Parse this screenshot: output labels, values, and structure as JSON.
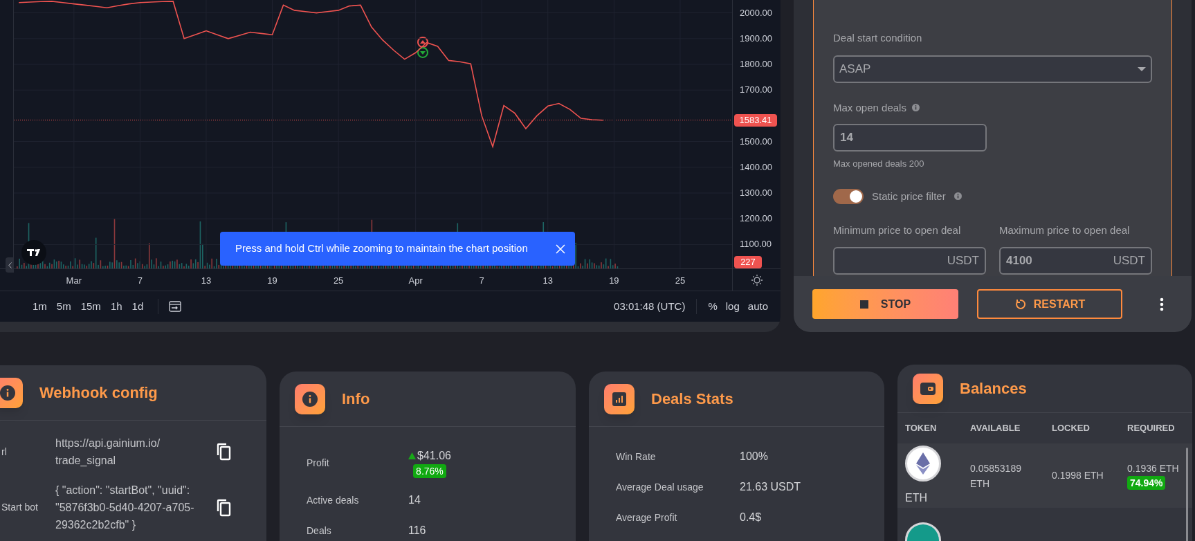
{
  "chart": {
    "volume_label": "227",
    "last_price": "1583.41",
    "chart_data": {
      "type": "line",
      "grid": true,
      "categories": [
        null,
        null,
        null,
        null,
        null,
        "Mar",
        null,
        null,
        null,
        null,
        null,
        "7",
        null,
        null,
        null,
        null,
        null,
        "13",
        null,
        null,
        null,
        null,
        null,
        "19",
        null,
        null,
        null,
        null,
        null,
        "25",
        null,
        null,
        null,
        null,
        null,
        null,
        "Apr",
        null,
        null,
        null,
        null,
        null,
        "7",
        null,
        null,
        null,
        null,
        null,
        "13",
        null,
        null,
        null,
        null,
        null,
        "19",
        null,
        null,
        null,
        null,
        null,
        "25",
        null,
        null,
        null,
        null
      ],
      "series": [
        {
          "color": "#ef5350",
          "values": [
            2040,
            2042,
            2044,
            2045,
            2040,
            2035,
            2030,
            2025,
            2020,
            2028,
            2035,
            2040,
            2042,
            2044,
            2045,
            1900,
            1915,
            1930,
            1915,
            1900,
            1912,
            1925,
            1920,
            1915,
            2030,
            2010,
            2005,
            2000,
            2005,
            2010,
            2027,
            2030,
            1945,
            1895,
            1855,
            1820,
            1845,
            1885,
            1870,
            1815,
            1810,
            1802,
            1600,
            1480,
            1640,
            1610,
            1550,
            1600,
            1638,
            1648,
            1625,
            1590,
            1585,
            1583,
            null,
            null,
            null,
            null,
            null,
            null,
            null,
            null,
            null,
            null,
            null
          ]
        }
      ],
      "ylim": [
        1007,
        2050
      ],
      "yticks": [
        {
          "value": 2000,
          "label": "2000.00"
        },
        {
          "value": 1900,
          "label": "1900.00"
        },
        {
          "value": 1800,
          "label": "1800.00"
        },
        {
          "value": 1700,
          "label": "1700.00"
        },
        {
          "value": 1500,
          "label": "1500.00"
        },
        {
          "value": 1400,
          "label": "1400.00"
        },
        {
          "value": 1300,
          "label": "1300.00"
        },
        {
          "value": 1200,
          "label": "1200.00"
        },
        {
          "value": 1100,
          "label": "1100.00"
        }
      ]
    }
  },
  "toast": {
    "text": "Press and hold Ctrl while zooming to maintain the chart position"
  },
  "toolbar": {
    "intervals": [
      "1m",
      "5m",
      "15m",
      "1h",
      "1d"
    ],
    "time": "03:01:48 (UTC)",
    "scale_options": [
      "%",
      "log",
      "auto"
    ]
  },
  "settings": {
    "deal_start_condition": {
      "label": "Deal start condition",
      "value": "ASAP"
    },
    "max_open_deals": {
      "label": "Max open deals",
      "value": "14",
      "helper": "Max opened deals 200"
    },
    "static_price_filter": {
      "label": "Static price filter",
      "on": true
    },
    "price_fields": [
      {
        "label": "Minimum price to open deal",
        "suffix": "USDT"
      },
      {
        "label": "Maximum price to open deal",
        "value": "4100",
        "suffix": "USDT"
      }
    ]
  },
  "actions": {
    "stop": "STOP",
    "restart": "RESTART"
  },
  "webhook": {
    "title": "Webhook config",
    "rows": [
      {
        "label": "rl",
        "value": "https://api.gainium.io/ trade_signal"
      },
      {
        "label": "Start bot",
        "value": "{ \"action\": \"startBot\", \"uuid\": \"5876f3b0-5d40-4207-a705-29362c2b2cfb\" }"
      }
    ]
  },
  "info": {
    "title": "Info",
    "rows": [
      {
        "kind": "profit",
        "label": "Profit",
        "value": "$41.06",
        "change": "8.76%"
      },
      {
        "kind": "plain",
        "label": "Active deals",
        "value": "14"
      },
      {
        "kind": "plain",
        "label": "Deals",
        "value": "116"
      }
    ]
  },
  "deals_stats": {
    "title": "Deals Stats",
    "rows": [
      {
        "label": "Win Rate",
        "value": "100%"
      },
      {
        "label": "Average Deal usage",
        "value": "21.63 USDT"
      },
      {
        "label": "Average Profit",
        "value": "0.4$"
      }
    ]
  },
  "balances": {
    "title": "Balances",
    "columns": [
      "TOKEN",
      "AVAILABLE",
      "LOCKED",
      "REQUIRED"
    ],
    "rows": [
      {
        "kind": "ethereum",
        "token": "ETH",
        "available": "0.05853189 ETH",
        "locked": "0.1998 ETH",
        "required": "0.1936 ETH",
        "required_share": "74.94%"
      },
      {
        "kind": "tether"
      }
    ]
  }
}
